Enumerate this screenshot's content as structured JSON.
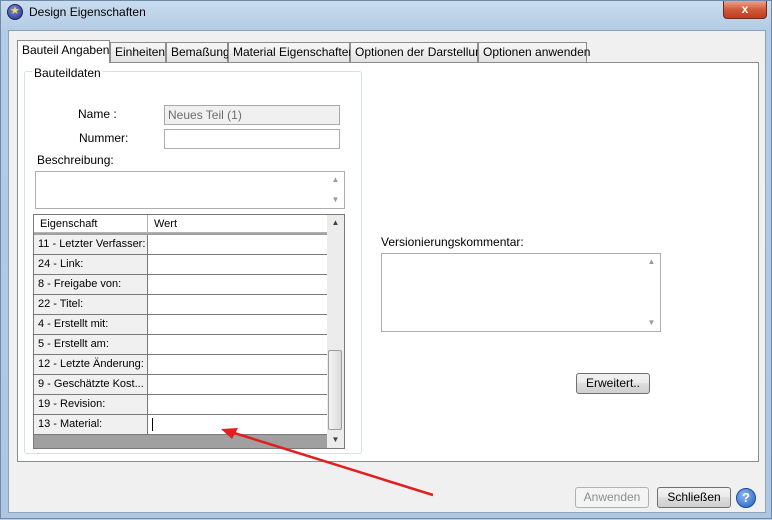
{
  "window": {
    "title": "Design Eigenschaften",
    "close_label": "x"
  },
  "tabs": [
    {
      "label": "Bauteil Angaben",
      "active": true
    },
    {
      "label": "Einheiten"
    },
    {
      "label": "Bemaßung"
    },
    {
      "label": "Material Eigenschaften"
    },
    {
      "label": "Optionen der Darstellung"
    },
    {
      "label": "Optionen anwenden"
    }
  ],
  "bauteil": {
    "group_title": "Bauteildaten",
    "name_label": "Name :",
    "name_value": "Neues Teil (1)",
    "number_label": "Nummer:",
    "number_value": "",
    "description_label": "Beschreibung:",
    "description_value": ""
  },
  "properties_grid": {
    "headers": [
      "Eigenschaft",
      "Wert"
    ],
    "rows": [
      {
        "property": "11 - Letzter Verfasser:",
        "value": ""
      },
      {
        "property": "24 - Link:",
        "value": ""
      },
      {
        "property": "8 - Freigabe von:",
        "value": ""
      },
      {
        "property": "22 - Titel:",
        "value": ""
      },
      {
        "property": "4 - Erstellt mit:",
        "value": ""
      },
      {
        "property": "5 - Erstellt am:",
        "value": ""
      },
      {
        "property": "12 - Letzte Änderung:",
        "value": ""
      },
      {
        "property": "9 - Geschätzte Kost...",
        "value": ""
      },
      {
        "property": "19 - Revision:",
        "value": ""
      },
      {
        "property": "13 - Material:",
        "value": ""
      }
    ]
  },
  "versioning": {
    "label": "Versionierungskommentar:",
    "value": ""
  },
  "buttons": {
    "advanced": "Erweitert..",
    "apply": "Anwenden",
    "close": "Schließen",
    "help": "?"
  },
  "colors": {
    "annotation_arrow": "#e31e1e",
    "titlebar": "#b9d1ea"
  }
}
